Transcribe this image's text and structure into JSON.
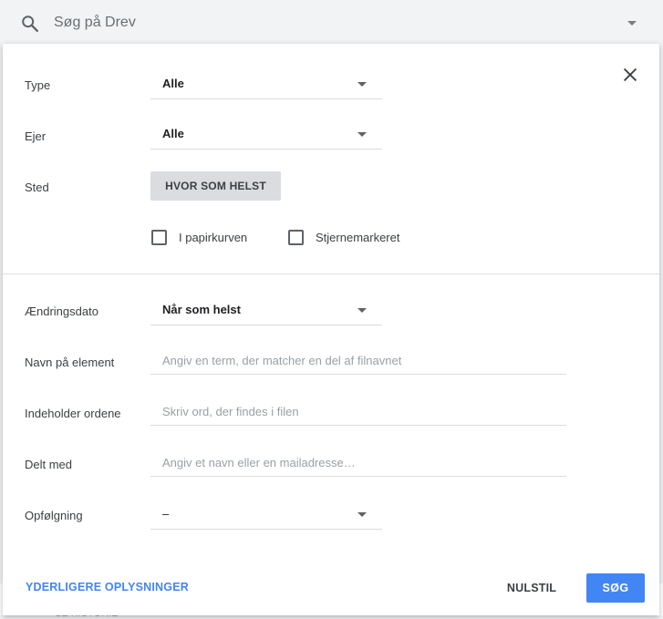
{
  "search": {
    "placeholder": "Søg på Drev"
  },
  "background": {
    "row_text": "SE HISTORIE"
  },
  "form": {
    "type": {
      "label": "Type",
      "value": "Alle"
    },
    "owner": {
      "label": "Ejer",
      "value": "Alle"
    },
    "location": {
      "label": "Sted",
      "chip": "HVOR SOM HELST"
    },
    "checkboxes": [
      {
        "label": "I papirkurven",
        "checked": false
      },
      {
        "label": "Stjernemarkeret",
        "checked": false
      }
    ],
    "modified": {
      "label": "Ændringsdato",
      "value": "Når som helst"
    },
    "item_name": {
      "label": "Navn på element",
      "placeholder": "Angiv en term, der matcher en del af filnavnet"
    },
    "has_words": {
      "label": "Indeholder ordene",
      "placeholder": "Skriv ord, der findes i filen"
    },
    "shared_with": {
      "label": "Delt med",
      "placeholder": "Angiv et navn eller en mailadresse…"
    },
    "follow_up": {
      "label": "Opfølgning",
      "value": "–"
    }
  },
  "footer": {
    "more_info": "YDERLIGERE OPLYSNINGER",
    "reset": "NULSTIL",
    "search": "SØG"
  },
  "colors": {
    "accent": "#4285f4",
    "chip_bg": "#dadce0"
  },
  "icons": {
    "search": "search-icon",
    "close": "close-icon",
    "dropdown": "caret-down-icon"
  }
}
